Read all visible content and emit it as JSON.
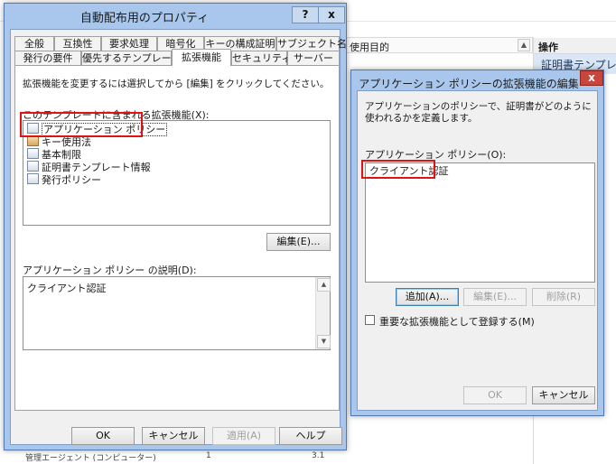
{
  "background": {
    "column_header": "使用目的",
    "operations_title": "操作",
    "operations_item": "証明書テンプレー",
    "bottom_text": "管理エージェント (コンピューター)",
    "bottom_num1": "1",
    "bottom_num2": "3.1"
  },
  "properties": {
    "title": "自動配布用のプロパティ",
    "help_btn": "?",
    "close_btn": "x",
    "tabs_row1": [
      "全般",
      "互換性",
      "要求処理",
      "暗号化",
      "キーの構成証明",
      "サブジェクト名"
    ],
    "tabs_row2": [
      "発行の要件",
      "優先するテンプレート",
      "拡張機能",
      "セキュリティ",
      "サーバー"
    ],
    "instruction": "拡張機能を変更するには選択してから [編集] をクリックしてください。",
    "ext_list_label": "このテンプレートに含まれる拡張機能(X):",
    "extensions": [
      "アプリケーション ポリシー",
      "キー使用法",
      "基本制限",
      "証明書テンプレート情報",
      "発行ポリシー"
    ],
    "edit_button": "編集(E)...",
    "desc_label": "アプリケーション ポリシー の説明(D):",
    "desc_text": "クライアント認証",
    "ok": "OK",
    "cancel": "キャンセル",
    "apply": "適用(A)",
    "help": "ヘルプ"
  },
  "edit_dialog": {
    "title": "アプリケーション ポリシーの拡張機能の編集",
    "close_btn": "x",
    "description": "アプリケーションのポリシーで、証明書がどのように使われるかを定義します。",
    "list_label": "アプリケーション ポリシー(O):",
    "policies": [
      "クライアント認証"
    ],
    "add": "追加(A)...",
    "edit": "編集(E)...",
    "remove": "削除(R)",
    "critical_label": "重要な拡張機能として登録する(M)",
    "critical_checked": false,
    "ok": "OK",
    "cancel": "キャンセル"
  },
  "colors": {
    "title_bar": "#a9c7ec",
    "highlight_border": "#e01212",
    "close_red": "#c9463d"
  }
}
